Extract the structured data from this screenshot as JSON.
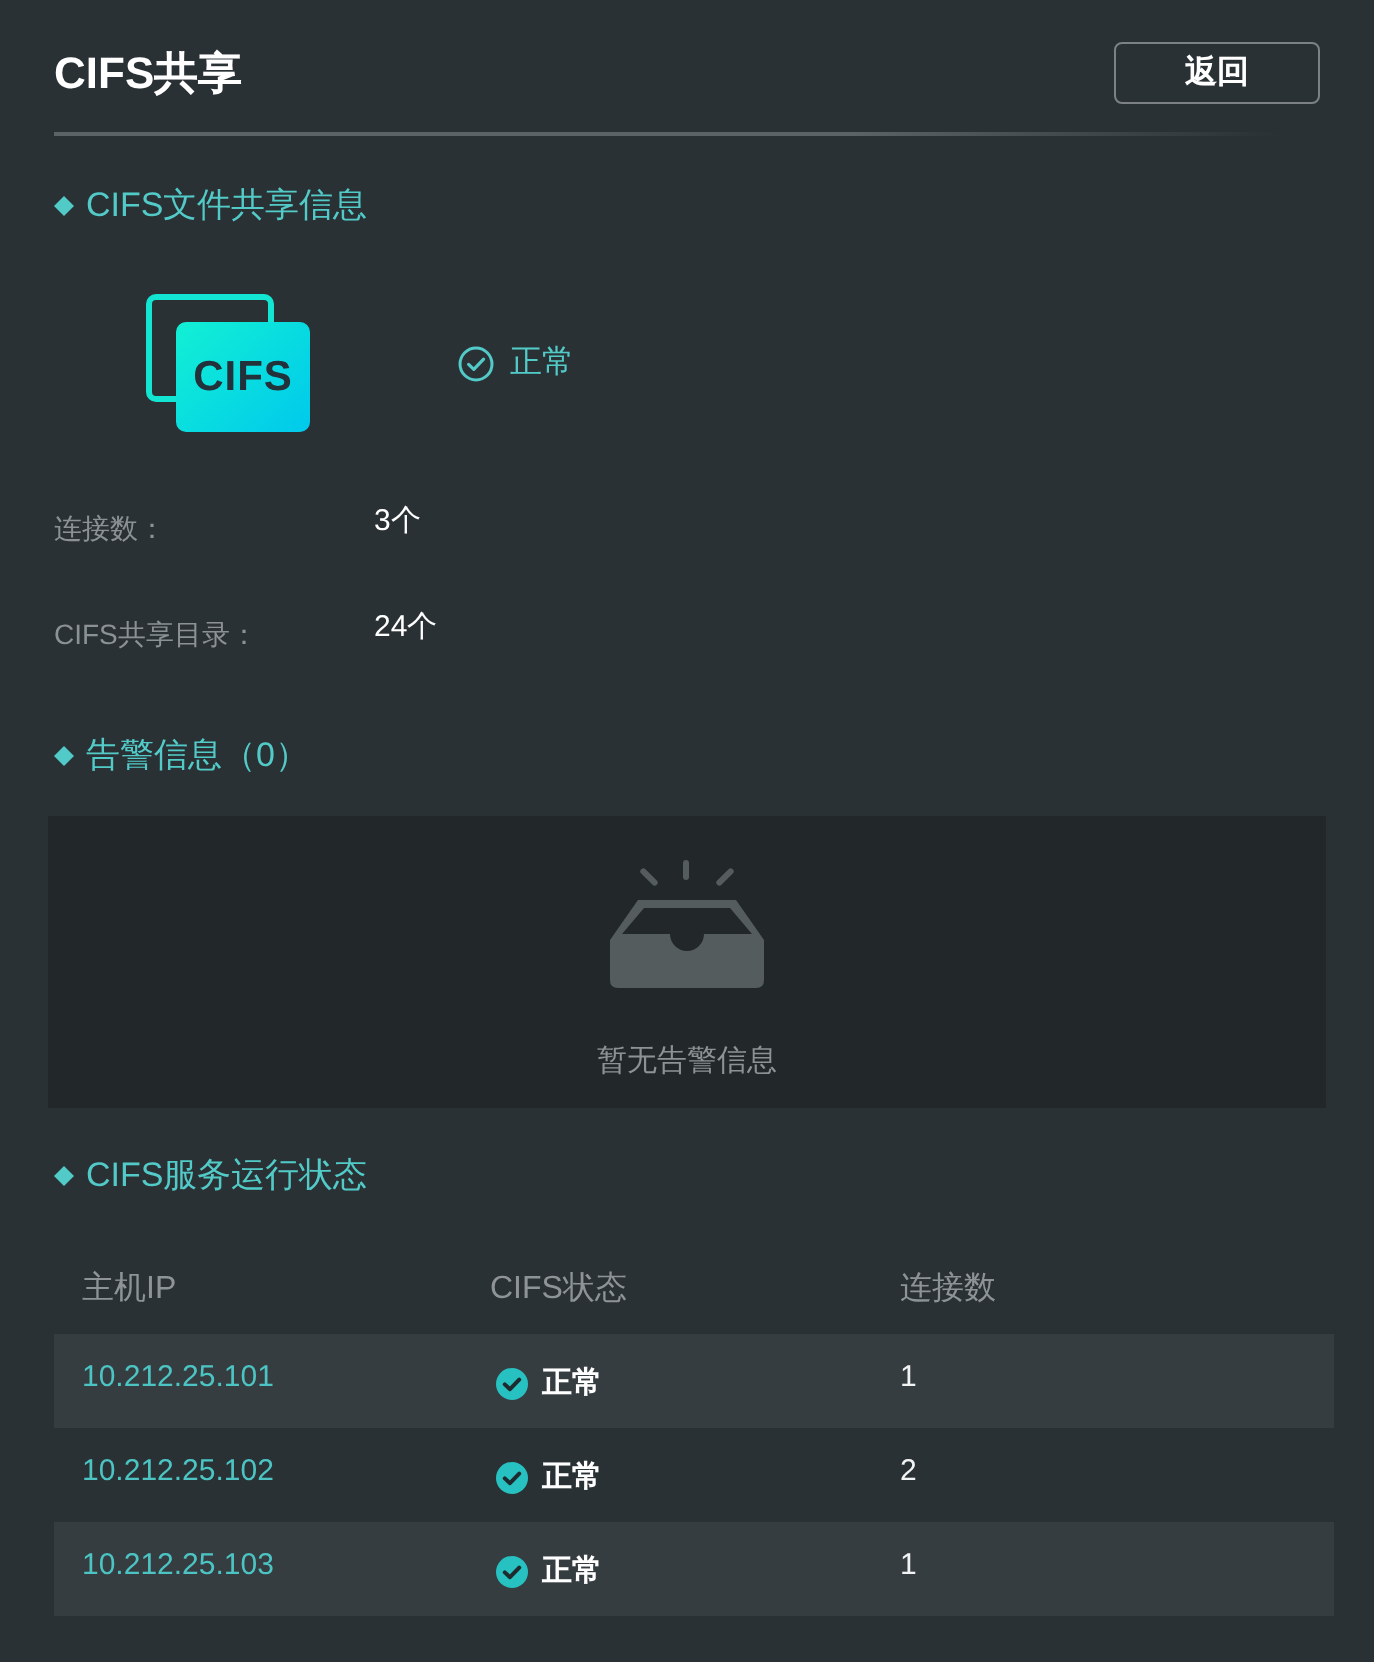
{
  "header": {
    "title": "CIFS共享",
    "back_button": "返回"
  },
  "file_share_info": {
    "heading": "CIFS文件共享信息",
    "logo_text": "CIFS",
    "status": "正常",
    "fields": [
      {
        "label": "连接数：",
        "value": "3个"
      },
      {
        "label": "CIFS共享目录：",
        "value": "24个"
      }
    ]
  },
  "alarms": {
    "heading": "告警信息（0）",
    "empty_text": "暂无告警信息"
  },
  "service_status": {
    "heading": "CIFS服务运行状态",
    "columns": [
      "主机IP",
      "CIFS状态",
      "连接数"
    ],
    "rows": [
      {
        "host_ip": "10.212.25.101",
        "status": "正常",
        "connections": "1"
      },
      {
        "host_ip": "10.212.25.102",
        "status": "正常",
        "connections": "2"
      },
      {
        "host_ip": "10.212.25.103",
        "status": "正常",
        "connections": "1"
      }
    ]
  }
}
